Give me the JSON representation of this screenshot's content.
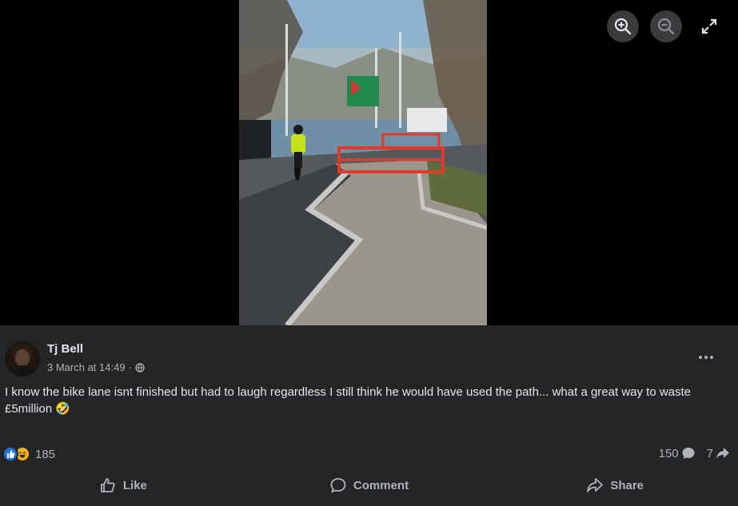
{
  "viewer": {
    "controls": [
      {
        "name": "zoom-in-button",
        "icon": "zoom-in-icon"
      },
      {
        "name": "zoom-out-button",
        "icon": "zoom-out-icon"
      },
      {
        "name": "fullscreen-button",
        "icon": "expand-icon"
      }
    ],
    "photo": {
      "subject": "cyclist on an unfinished bike lane with red construction barriers"
    }
  },
  "post": {
    "author": "Tj Bell",
    "timestamp": "3 March at 14:49",
    "separator": "·",
    "audience_icon": "globe-icon",
    "text": "I know the bike lane isnt finished but had to laugh regardless I still think he would have used the path... what a great way to waste £5million 🤣",
    "reactions": {
      "icons": [
        "like-icon",
        "haha-icon"
      ],
      "count": "185"
    },
    "comments_count": "150",
    "shares_count": "7",
    "actions": {
      "like": "Like",
      "comment": "Comment",
      "share": "Share"
    }
  },
  "colors": {
    "panel_bg": "#242526",
    "viewer_bg": "#000000",
    "text_primary": "#e4e6eb",
    "text_secondary": "#b0b3b8",
    "like_blue": "#1b74e4",
    "haha_yellow": "#f7b125"
  }
}
